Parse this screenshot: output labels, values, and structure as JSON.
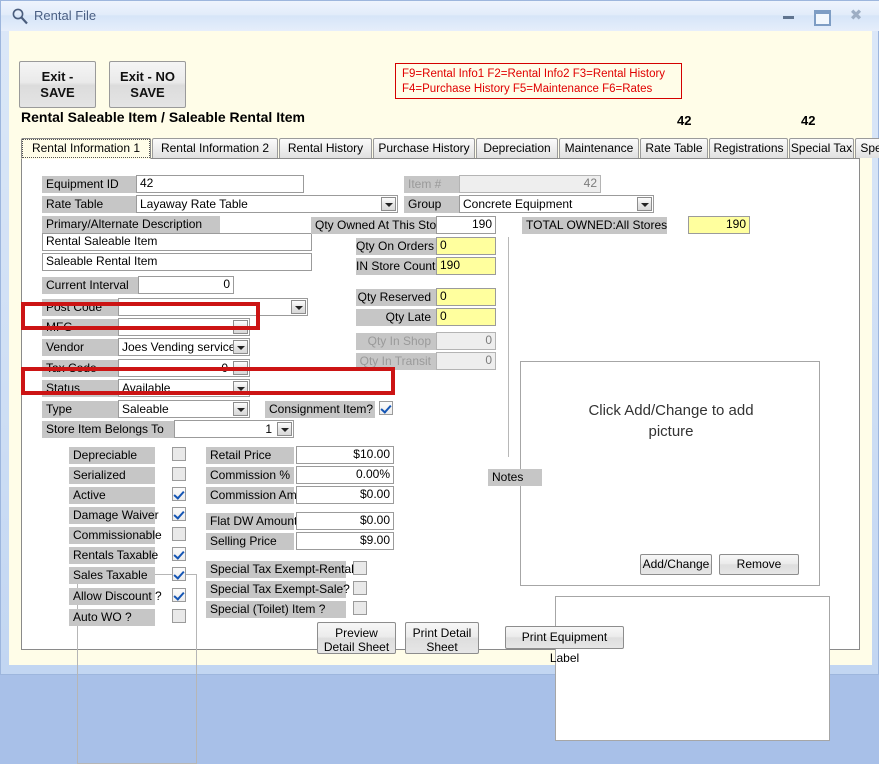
{
  "window": {
    "title": "Rental File",
    "icon": "magnifier-icon",
    "minimize": "minimize",
    "maximize": "maximize",
    "close": "close"
  },
  "toolbar": {
    "exit_save_line1": "Exit -",
    "exit_save_line2": "SAVE",
    "exit_nosave_line1": "Exit -  NO",
    "exit_nosave_line2": "SAVE",
    "fkey_line1": "F9=Rental Info1  F2=Rental Info2  F3=Rental History",
    "fkey_line2": "F4=Purchase History  F5=Maintenance  F6=Rates",
    "fkey_color": "#e00000"
  },
  "header": {
    "page_title": "Rental Saleable Item /  Saleable Rental Item",
    "top_number_1": "42",
    "top_number_2": "42"
  },
  "tabs": [
    {
      "label": "Rental Information 1",
      "active": true
    },
    {
      "label": "Rental Information 2",
      "active": false
    },
    {
      "label": "Rental History",
      "active": false
    },
    {
      "label": "Purchase History",
      "active": false
    },
    {
      "label": "Depreciation",
      "active": false
    },
    {
      "label": "Maintenance",
      "active": false
    },
    {
      "label": "Rate Table",
      "active": false
    },
    {
      "label": "Registrations",
      "active": false
    },
    {
      "label": "Special Tax",
      "active": false
    },
    {
      "label": "Specs",
      "active": false
    }
  ],
  "form": {
    "equipment_id_label": "Equipment ID",
    "equipment_id_value": "42",
    "rate_table_label": "Rate Table",
    "rate_table_value": "Layaway Rate Table",
    "primary_alt_label": "Primary/Alternate Description",
    "primary_description": "Rental Saleable Item",
    "alternate_description": "Saleable Rental Item",
    "current_interval_label": "Current Interval",
    "current_interval_value": "0",
    "post_code_label": "Post Code",
    "post_code_value": "",
    "mfg_label": "MFG",
    "mfg_value": "",
    "vendor_label": "Vendor",
    "vendor_value": "Joes Vending service",
    "tax_code_label": "Tax Code",
    "tax_code_value": "0",
    "status_label": "Status",
    "status_value": "Available",
    "type_label": "Type",
    "type_value": "Saleable",
    "consignment_label": "Consignment Item?",
    "consignment_checked": true,
    "store_belongs_label": "Store Item Belongs To",
    "store_belongs_value": "1"
  },
  "quantities": {
    "item_number_label": "Item #",
    "item_number_value": "42",
    "group_label": "Group",
    "group_value": "Concrete Equipment",
    "qty_owned_label": "Qty Owned At This Store",
    "qty_owned_value": "190",
    "total_owned_label": "TOTAL OWNED:All Stores",
    "total_owned_value": "190",
    "qty_on_orders_label": "Qty On  Orders",
    "qty_on_orders_value": "0",
    "in_store_count_label": "IN Store Count",
    "in_store_count_value": "190",
    "qty_reserved_label": "Qty Reserved",
    "qty_reserved_value": "0",
    "qty_late_label": "Qty Late",
    "qty_late_value": "0",
    "qty_in_shop_label": "Qty In Shop",
    "qty_in_shop_value": "0",
    "qty_in_transit_label": "Qty In Transit",
    "qty_in_transit_value": "0"
  },
  "picture": {
    "hint_line1": "Click Add/Change to add",
    "hint_line2": "picture",
    "add_change_label": "Add/Change",
    "remove_label": "Remove"
  },
  "notes": {
    "label": "Notes",
    "value": ""
  },
  "flags": [
    {
      "label": "Depreciable",
      "checked": false
    },
    {
      "label": "Serialized",
      "checked": false
    },
    {
      "label": "Active",
      "checked": true
    },
    {
      "label": "Damage Waiver",
      "checked": true
    },
    {
      "label": "Commissionable",
      "checked": false
    },
    {
      "label": "Rentals Taxable",
      "checked": true
    },
    {
      "label": "Sales Taxable",
      "checked": true
    },
    {
      "label": "Allow Discount ?",
      "checked": true
    },
    {
      "label": "Auto WO ?",
      "checked": false
    }
  ],
  "prices": [
    {
      "label": "Retail Price",
      "value": "$10.00"
    },
    {
      "label": "Commission %",
      "value": "0.00%"
    },
    {
      "label": "Commission Amt",
      "value": "$0.00"
    },
    {
      "label": "Flat DW Amount",
      "value": "$0.00"
    },
    {
      "label": "Selling Price",
      "value": "$9.00"
    }
  ],
  "special_tax": [
    {
      "label": "Special Tax Exempt-Rental?",
      "checked": false
    },
    {
      "label": "Special Tax Exempt-Sale?",
      "checked": false
    },
    {
      "label": "Special (Toilet) Item ?",
      "checked": false
    }
  ],
  "footer": {
    "preview_line1": "Preview",
    "preview_line2": "Detail Sheet",
    "print_line1": "Print Detail",
    "print_line2": "Sheet",
    "print_label": "Print Equipment Label"
  },
  "colors": {
    "highlight_red": "#cc1414",
    "yellow_field": "#ffff9e",
    "client_background": "#fffde8",
    "label_background": "#c6c6c6"
  }
}
